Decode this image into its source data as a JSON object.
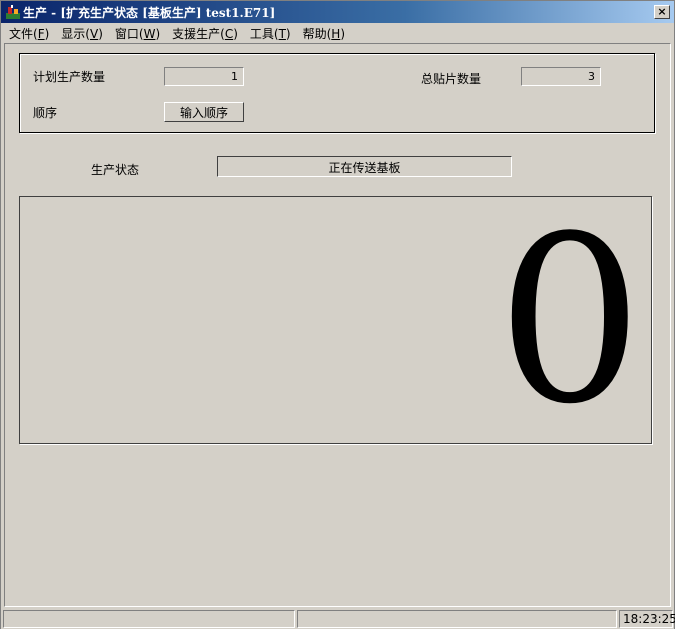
{
  "window": {
    "title": "生产 - [扩充生产状态 [基板生产] test1.E71]",
    "close_label": "×"
  },
  "menu": [
    {
      "label": "文件(",
      "acc": "F",
      "end": ")"
    },
    {
      "label": "显示(",
      "acc": "V",
      "end": ")"
    },
    {
      "label": "窗口(",
      "acc": "W",
      "end": ")"
    },
    {
      "label": "支援生产(",
      "acc": "C",
      "end": ")"
    },
    {
      "label": "工具(",
      "acc": "T",
      "end": ")"
    },
    {
      "label": "帮助(",
      "acc": "H",
      "end": ")"
    }
  ],
  "production": {
    "planned_qty_label": "计划生产数量",
    "planned_qty_value": "1",
    "total_placed_label": "总贴片数量",
    "total_placed_value": "3",
    "sequence_label": "顺序",
    "sequence_button": "输入顺序"
  },
  "status": {
    "label": "生产状态",
    "value": "正在传送基板"
  },
  "counter": {
    "value": "0"
  },
  "statusbar": {
    "time": "18:23:25"
  }
}
